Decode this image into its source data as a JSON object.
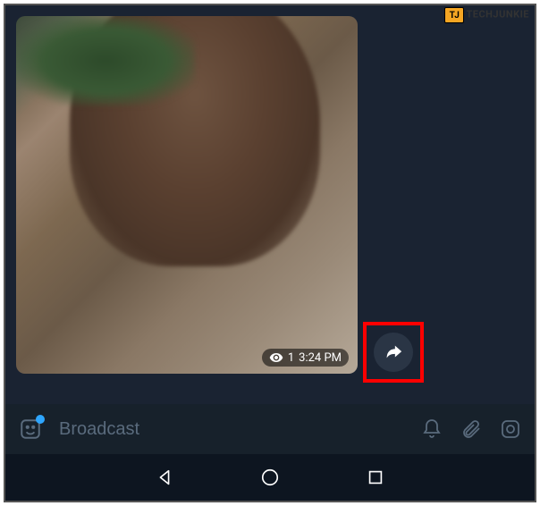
{
  "watermark": {
    "badge": "TJ",
    "text": "TECHJUNKIE"
  },
  "message": {
    "view_count": "1",
    "time": "3:24 PM"
  },
  "input": {
    "placeholder": "Broadcast"
  },
  "highlight": {
    "color": "#ff0000"
  }
}
